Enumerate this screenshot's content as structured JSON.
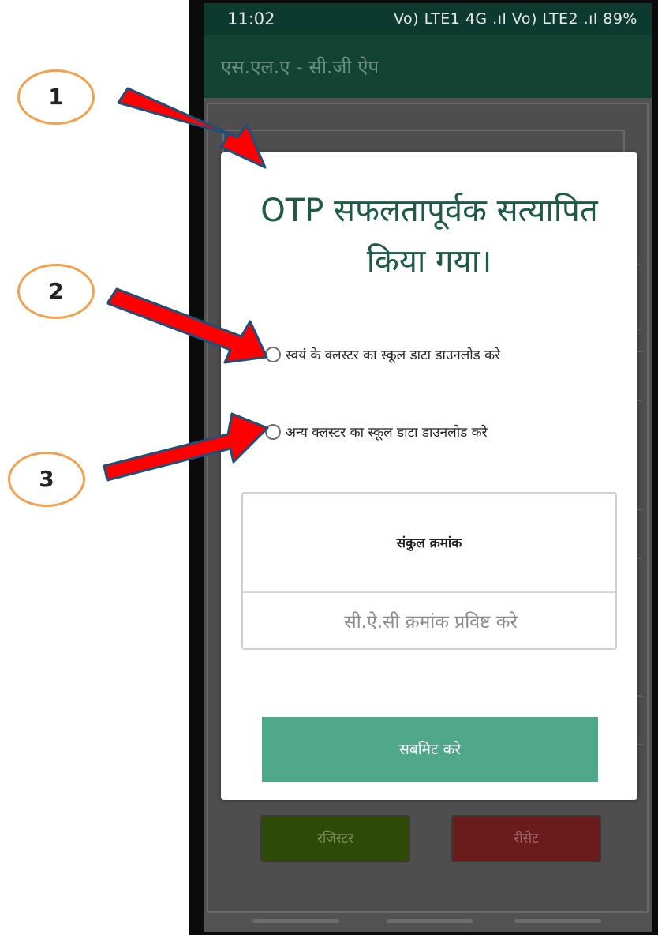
{
  "status_bar": {
    "time": "11:02",
    "indicators": "Vo) LTE1 4G .ıl Vo) LTE2 .ıl 89%"
  },
  "app_bar": {
    "title": "एस.एल.ए - सी.जी ऐप"
  },
  "dialog": {
    "title_line1": "OTP सफलतापूर्वक सत्यापित",
    "title_line2": "किया गया।",
    "option_own": "स्वयं के क्लस्टर का स्कूल डाटा डाउनलोड करे",
    "option_other": "अन्य क्लस्टर का स्कूल डाटा डाउनलोड करे",
    "cluster_label": "संकुल क्रमांक",
    "cluster_placeholder": "सी.ऐ.सी क्रमांक प्रविष्ट करे",
    "submit_label": "सबमिट करे"
  },
  "background": {
    "register_label": "रजिस्टर",
    "reset_label": "रीसेट"
  },
  "annotations": [
    "1",
    "2",
    "3"
  ],
  "colors": {
    "accent_green": "#4fa88a",
    "title_green": "#1e5a46",
    "arrow_red": "#ff0000",
    "badge_orange": "#f2a24e"
  }
}
